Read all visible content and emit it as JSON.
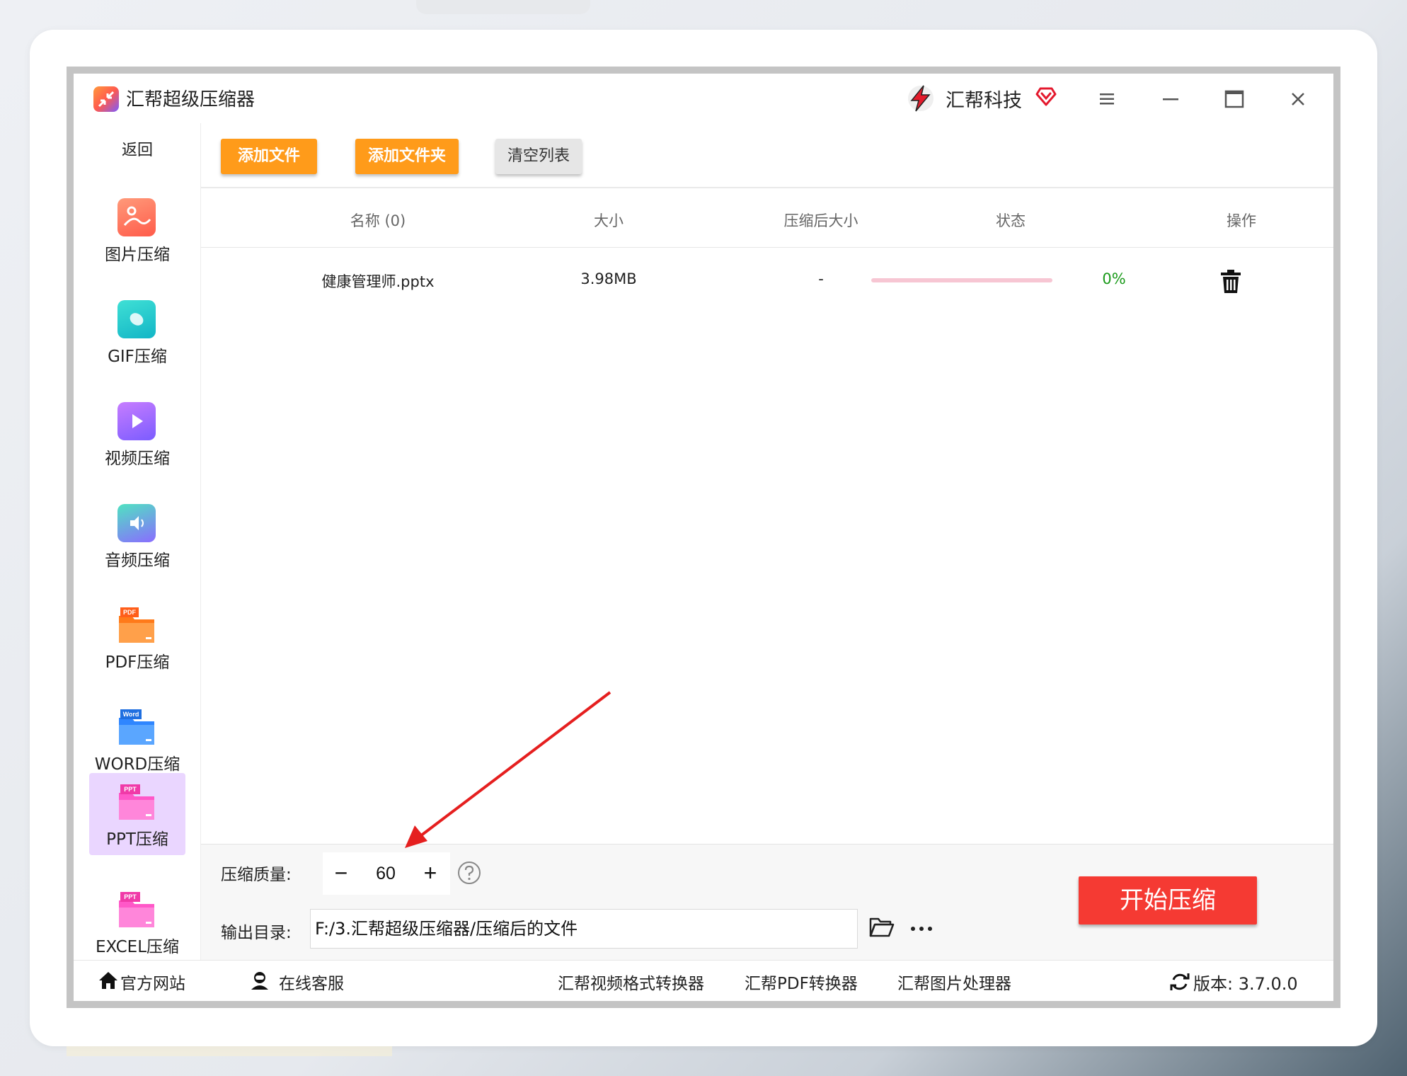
{
  "app": {
    "title": "汇帮超级压缩器",
    "brand": "汇帮科技"
  },
  "sidebar": {
    "back": "返回",
    "items": [
      {
        "label": "图片压缩",
        "icon": "image-compress-icon"
      },
      {
        "label": "GIF压缩",
        "icon": "gif-compress-icon"
      },
      {
        "label": "视频压缩",
        "icon": "video-compress-icon"
      },
      {
        "label": "音频压缩",
        "icon": "audio-compress-icon"
      },
      {
        "label": "PDF压缩",
        "icon": "pdf-compress-icon"
      },
      {
        "label": "WORD压缩",
        "icon": "word-compress-icon"
      },
      {
        "label": "PPT压缩",
        "icon": "ppt-compress-icon",
        "active": true
      },
      {
        "label": "EXCEL压缩",
        "icon": "excel-compress-icon"
      }
    ],
    "icon_tags": {
      "pdf": "PDF",
      "word": "Word",
      "ppt": "PPT",
      "excel": "PPT"
    }
  },
  "toolbar": {
    "add_file": "添加文件",
    "add_folder": "添加文件夹",
    "clear_list": "清空列表"
  },
  "table": {
    "headers": [
      "名称 (0)",
      "大小",
      "压缩后大小",
      "状态",
      "操作"
    ],
    "rows": [
      {
        "name": "健康管理师.pptx",
        "size": "3.98MB",
        "compressed_size": "-",
        "progress": 0,
        "progress_text": "0%"
      }
    ]
  },
  "settings": {
    "quality_label": "压缩质量:",
    "quality_value": "60",
    "output_label": "输出目录:",
    "output_path": "F:/3.汇帮超级压缩器/压缩后的文件",
    "start_label": "开始压缩"
  },
  "footer": {
    "website": "官方网站",
    "support": "在线客服",
    "links": [
      "汇帮视频格式转换器",
      "汇帮PDF转换器",
      "汇帮图片处理器"
    ],
    "version": "版本:  3.7.0.0"
  },
  "colors": {
    "accent_orange": "#ff9b1a",
    "start_red": "#f53a33",
    "active_side": "#ead6ff",
    "progress_track": "#f7c6d3",
    "percent_green": "#1a9a1a"
  }
}
